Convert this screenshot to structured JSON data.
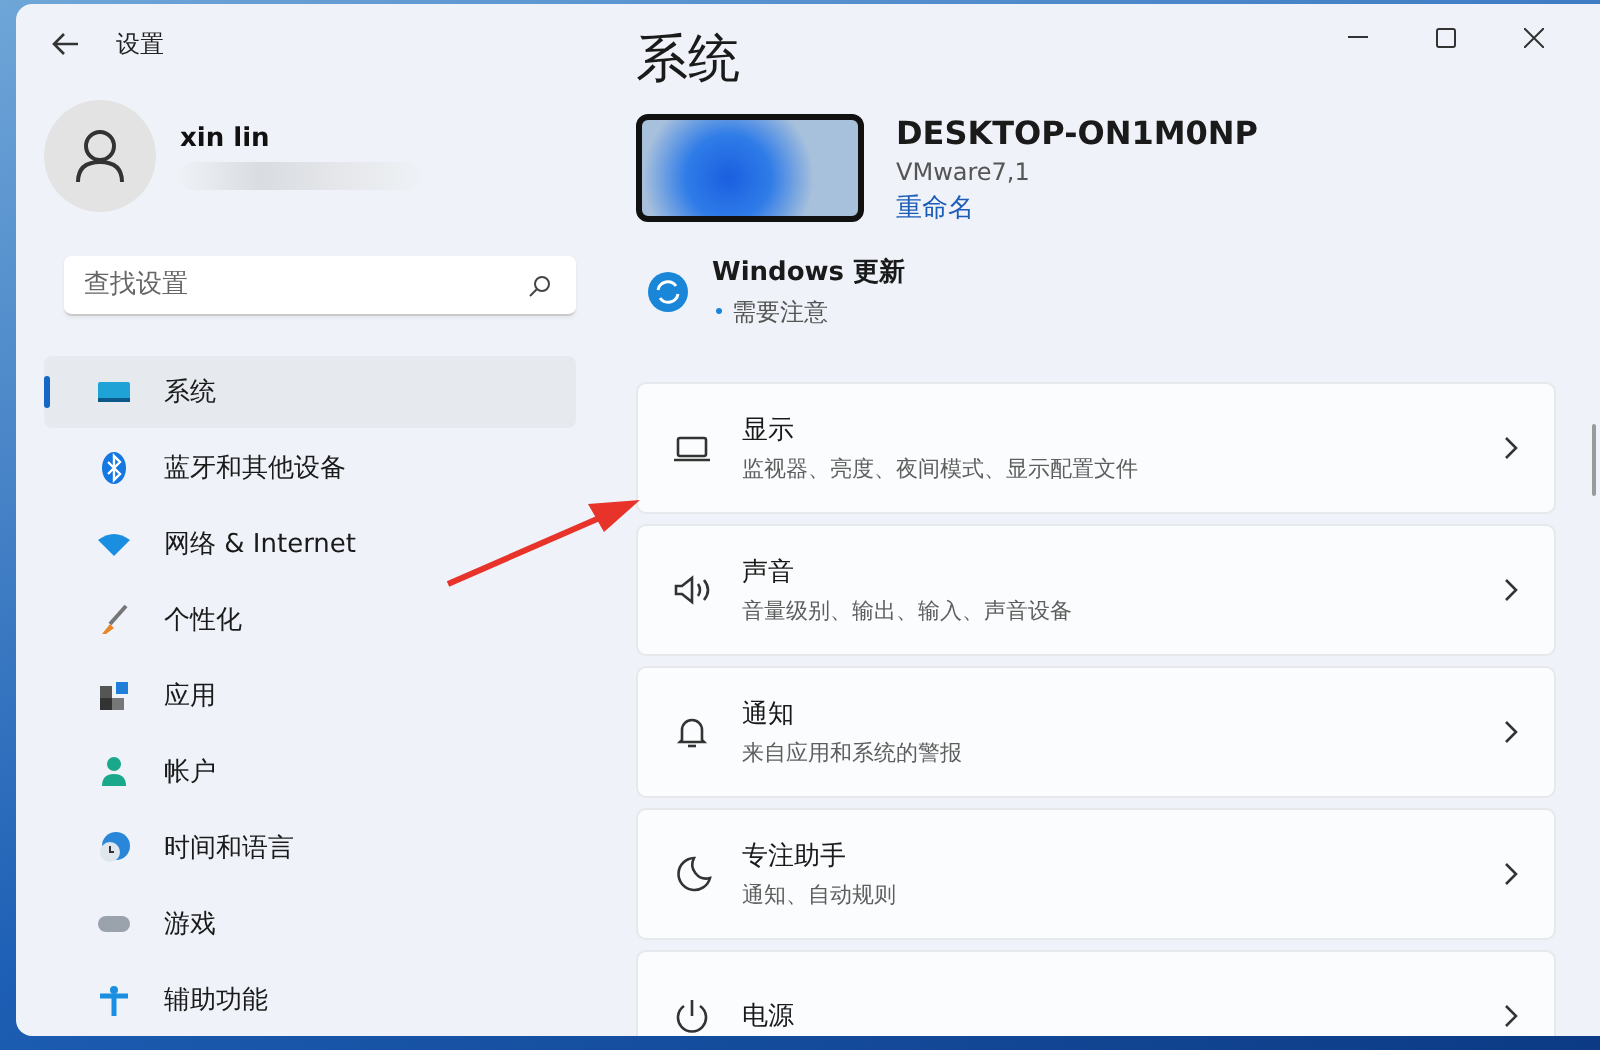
{
  "window": {
    "title": "设置"
  },
  "user": {
    "name": "xin lin"
  },
  "search": {
    "placeholder": "查找设置"
  },
  "sidebar": {
    "items": [
      {
        "label": "系统",
        "selected": true
      },
      {
        "label": "蓝牙和其他设备",
        "selected": false
      },
      {
        "label": "网络 & Internet",
        "selected": false
      },
      {
        "label": "个性化",
        "selected": false
      },
      {
        "label": "应用",
        "selected": false
      },
      {
        "label": "帐户",
        "selected": false
      },
      {
        "label": "时间和语言",
        "selected": false
      },
      {
        "label": "游戏",
        "selected": false
      },
      {
        "label": "辅助功能",
        "selected": false
      }
    ]
  },
  "page": {
    "title": "系统",
    "device": {
      "name": "DESKTOP-ON1M0NP",
      "model": "VMware7,1",
      "rename": "重命名"
    },
    "update": {
      "title": "Windows 更新",
      "status": "需要注意"
    },
    "cards": [
      {
        "title": "显示",
        "subtitle": "监视器、亮度、夜间模式、显示配置文件"
      },
      {
        "title": "声音",
        "subtitle": "音量级别、输出、输入、声音设备"
      },
      {
        "title": "通知",
        "subtitle": "来自应用和系统的警报"
      },
      {
        "title": "专注助手",
        "subtitle": "通知、自动规则"
      },
      {
        "title": "电源"
      }
    ]
  }
}
